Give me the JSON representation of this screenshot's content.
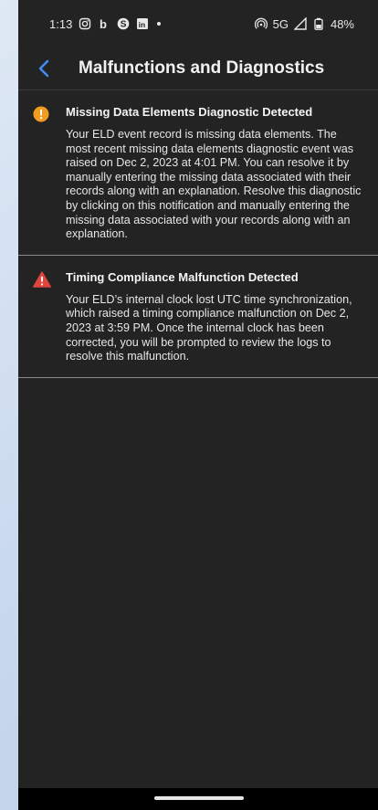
{
  "status_bar": {
    "time": "1:13",
    "network": "5G",
    "battery": "48%",
    "app_icons": [
      "instagram-icon",
      "b-app-icon",
      "s-app-icon",
      "linkedin-icon"
    ]
  },
  "app_bar": {
    "title": "Malfunctions and Diagnostics"
  },
  "items": [
    {
      "icon": "warning-circle-icon",
      "color": "#f29b1f",
      "title": "Missing Data Elements Diagnostic Detected",
      "text": "Your ELD event record is missing data elements. The most recent missing data elements diagnostic event was raised on Dec 2, 2023 at 4:01 PM. You can resolve it by manually entering the missing data associated with their records along with an explanation. Resolve this diagnostic by clicking on this notification and manually entering the missing data associated with your records along with an explanation."
    },
    {
      "icon": "warning-triangle-icon",
      "color": "#e0443f",
      "title": "Timing Compliance Malfunction Detected",
      "text": "Your ELD’s internal clock lost UTC time synchronization, which raised a timing compliance malfunction on Dec 2, 2023 at 3:59 PM. Once the internal clock has been corrected, you will be prompted to review the logs to resolve this malfunction."
    }
  ],
  "colors": {
    "background": "#232323",
    "accent": "#3d8df5"
  }
}
